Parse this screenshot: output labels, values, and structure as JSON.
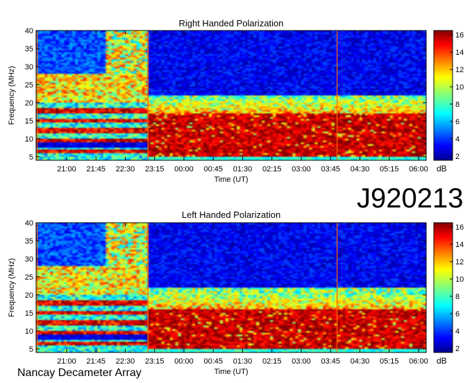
{
  "figure": {
    "observation_id": "J920213",
    "instrument": "Nancay Decameter Array"
  },
  "chart_data": [
    {
      "type": "heatmap",
      "title": "Right Handed Polarization",
      "xlabel": "Time (UT)",
      "ylabel": "Frequency (MHz)",
      "x_tick_labels": [
        "21:00",
        "21:45",
        "22:30",
        "23:15",
        "00:00",
        "00:45",
        "01:30",
        "02:15",
        "03:00",
        "03:45",
        "04:30",
        "05:15",
        "06:00"
      ],
      "y_ticks": [
        5,
        10,
        15,
        20,
        25,
        30,
        35,
        40
      ],
      "ylim": [
        4,
        40
      ],
      "colorbar": {
        "label": "dB",
        "ticks": [
          2,
          4,
          6,
          8,
          10,
          12,
          14,
          16
        ],
        "range": [
          1.5,
          16.5
        ],
        "colormap": "jet"
      },
      "features": {
        "burst_region_time": [
          "20:15",
          "23:05"
        ],
        "burst_region_freq_mhz": [
          5,
          40
        ],
        "strong_emission_after_time": "23:05",
        "strong_emission_freq_mhz": [
          5,
          17
        ]
      }
    },
    {
      "type": "heatmap",
      "title": "Left Handed Polarization",
      "xlabel": "Time (UT)",
      "ylabel": "Frequency (MHz)",
      "x_tick_labels": [
        "21:00",
        "21:45",
        "22:30",
        "23:15",
        "00:00",
        "00:45",
        "01:30",
        "02:15",
        "03:00",
        "03:45",
        "04:30",
        "05:15",
        "06:00"
      ],
      "y_ticks": [
        5,
        10,
        15,
        20,
        25,
        30,
        35,
        40
      ],
      "ylim": [
        4,
        40
      ],
      "colorbar": {
        "label": "dB",
        "ticks": [
          2,
          4,
          6,
          8,
          10,
          12,
          14,
          16
        ],
        "range": [
          1.5,
          16.5
        ],
        "colormap": "jet"
      },
      "features": {
        "burst_region_time": [
          "20:15",
          "23:05"
        ],
        "burst_region_freq_mhz": [
          5,
          40
        ],
        "strong_emission_after_time": "23:05",
        "strong_emission_freq_mhz": [
          5,
          16
        ]
      }
    }
  ]
}
